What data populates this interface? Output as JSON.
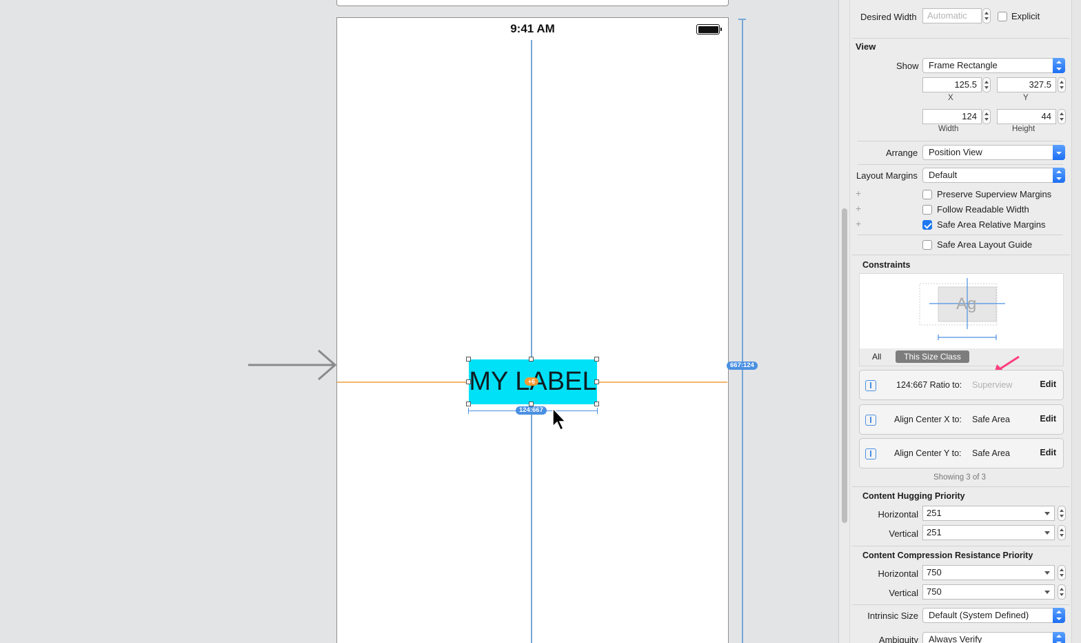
{
  "canvas": {
    "status_time": "9:41 AM",
    "label_text": "MY LABEL",
    "label_bg": "#00e1f7",
    "ratio_badge": "124:667",
    "side_badge": "667:124",
    "center_badge": "+6",
    "guide_color": "#76a6d6",
    "horizontal_guide_color": "#f3b56c"
  },
  "inspector": {
    "desired_width": {
      "label": "Desired Width",
      "placeholder": "Automatic",
      "explicit_label": "Explicit",
      "explicit_checked": false
    },
    "view_section": {
      "title": "View",
      "show_label": "Show",
      "show_value": "Frame Rectangle",
      "x_value": "125.5",
      "x_label": "X",
      "y_value": "327.5",
      "y_label": "Y",
      "width_value": "124",
      "width_label": "Width",
      "height_value": "44",
      "height_label": "Height",
      "arrange_label": "Arrange",
      "arrange_value": "Position View",
      "layout_margins_label": "Layout Margins",
      "layout_margins_value": "Default",
      "preserve_superview_margins": {
        "label": "Preserve Superview Margins",
        "checked": false
      },
      "follow_readable_width": {
        "label": "Follow Readable Width",
        "checked": false
      },
      "safe_area_relative_margins": {
        "label": "Safe Area Relative Margins",
        "checked": true
      },
      "safe_area_layout_guide": {
        "label": "Safe Area Layout Guide",
        "checked": false
      }
    },
    "constraints": {
      "title": "Constraints",
      "preview_text": "Ag",
      "segment_all": "All",
      "segment_active": "This Size Class",
      "items": [
        {
          "label": "124:667 Ratio to:",
          "target": "Superview",
          "target_dimmed": true,
          "edit": "Edit",
          "icon": "aspect-ratio-icon"
        },
        {
          "label": "Align Center X to:",
          "target": "Safe Area",
          "target_dimmed": false,
          "edit": "Edit",
          "icon": "align-center-x-icon"
        },
        {
          "label": "Align Center Y to:",
          "target": "Safe Area",
          "target_dimmed": false,
          "edit": "Edit",
          "icon": "align-center-y-icon"
        }
      ],
      "showing": "Showing 3 of 3"
    },
    "content_hugging": {
      "title": "Content Hugging Priority",
      "horizontal_label": "Horizontal",
      "horizontal_value": "251",
      "vertical_label": "Vertical",
      "vertical_value": "251"
    },
    "compression_resistance": {
      "title": "Content Compression Resistance Priority",
      "horizontal_label": "Horizontal",
      "horizontal_value": "750",
      "vertical_label": "Vertical",
      "vertical_value": "750"
    },
    "intrinsic_size": {
      "label": "Intrinsic Size",
      "value": "Default (System Defined)"
    },
    "ambiguity": {
      "label": "Ambiguity",
      "value": "Always Verify"
    }
  }
}
